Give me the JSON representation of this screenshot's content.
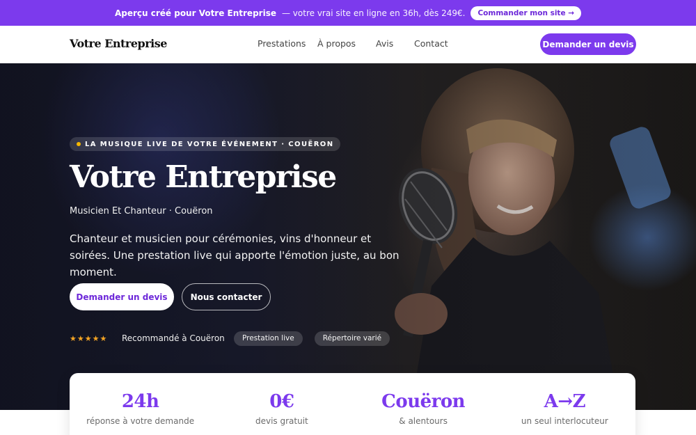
{
  "promo": {
    "bold": "Aperçu créé pour Votre Entreprise",
    "text": "— votre vrai site en ligne en 36h, dès 249€.",
    "button": "Commander mon site →"
  },
  "nav": {
    "brand": "Votre Entreprise",
    "items": [
      {
        "label": "Prestations"
      },
      {
        "label": "À propos"
      },
      {
        "label": "Avis"
      },
      {
        "label": "Contact"
      }
    ],
    "cta": "Demander un devis"
  },
  "hero": {
    "eyebrow": "LA MUSIQUE LIVE DE VOTRE ÉVÉNEMENT · COUËRON",
    "title": "Votre Entreprise",
    "subtitle": "Musicien Et Chanteur · Couëron",
    "description": "Chanteur et musicien pour cérémonies, vins d'honneur et soirées. Une prestation live qui apporte l'émotion juste, au bon moment.",
    "primary_button": "Demander un devis",
    "secondary_button": "Nous contacter",
    "stars": "★★★★★",
    "rating": 5,
    "trust_label": "Recommandé à Couëron",
    "chips": [
      {
        "label": "Prestation live"
      },
      {
        "label": "Répertoire varié"
      }
    ]
  },
  "stats": [
    {
      "value": "24h",
      "label": "réponse à votre demande"
    },
    {
      "value": "0€",
      "label": "devis gratuit"
    },
    {
      "value": "Couëron",
      "label": "& alentours"
    },
    {
      "value": "A→Z",
      "label": "un seul interlocuteur"
    }
  ],
  "colors": {
    "accent": "#7c3aed",
    "star": "#f5a524",
    "eyebrow_dot": "#f5b700"
  },
  "icons": {
    "eyebrow_dot": "dot-icon",
    "stars": "star-icon"
  }
}
